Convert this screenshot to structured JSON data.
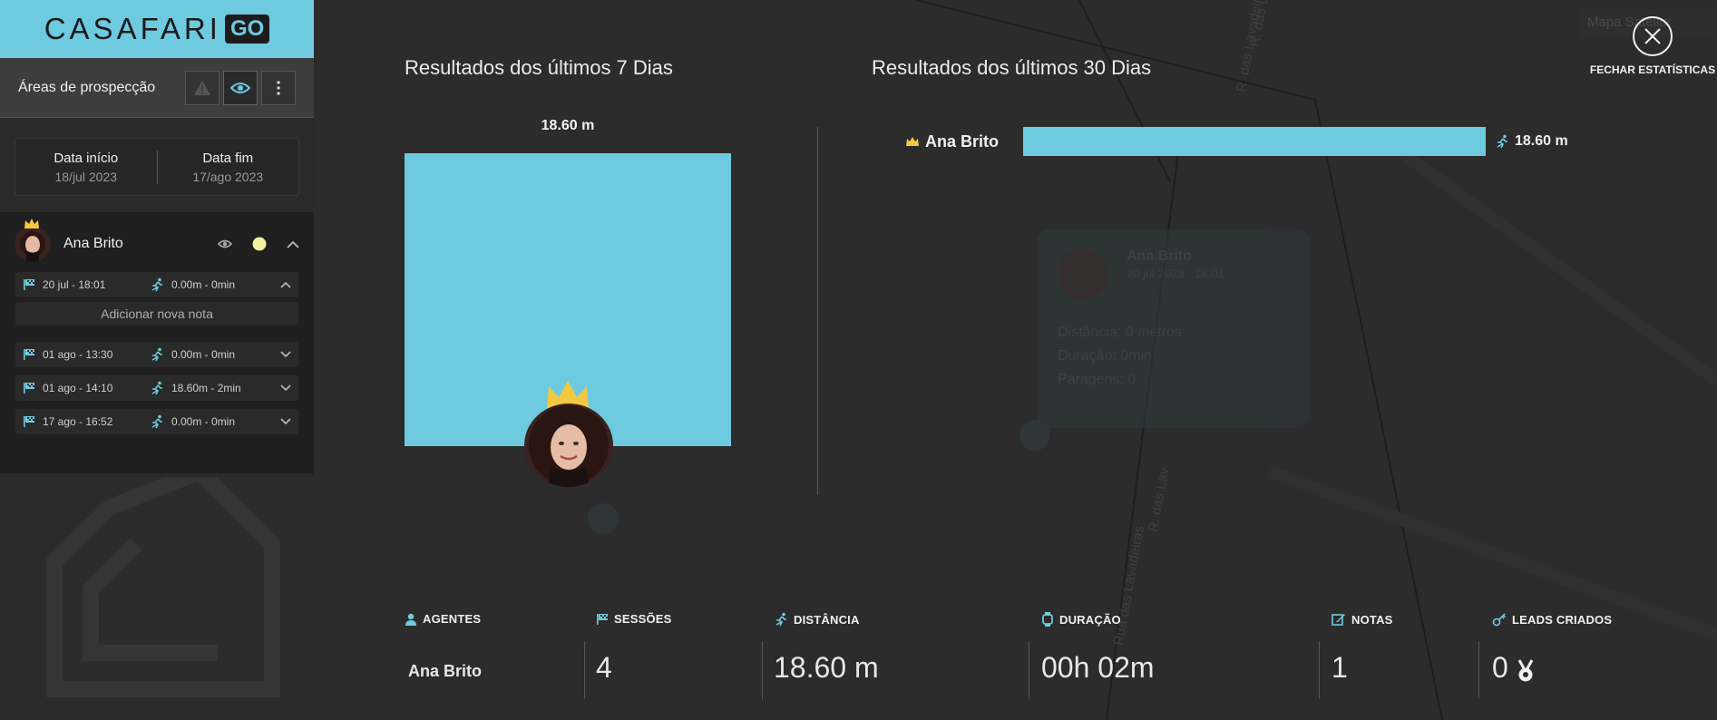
{
  "logo": {
    "text": "CASAFARI",
    "badge": "GO"
  },
  "sidebar": {
    "areas_title": "Áreas de prospecção",
    "date_start_label": "Data início",
    "date_start_value": "18/jul 2023",
    "date_end_label": "Data fim",
    "date_end_value": "17/ago 2023",
    "agent_name": "Ana Brito",
    "add_note_label": "Adicionar nova nota",
    "sessions": [
      {
        "date": "20 jul - 18:01",
        "distance": "0.00m - 0min",
        "expanded": true
      },
      {
        "date": "01 ago - 13:30",
        "distance": "0.00m - 0min",
        "expanded": false
      },
      {
        "date": "01 ago - 14:10",
        "distance": "18.60m - 2min",
        "expanded": false
      },
      {
        "date": "17 ago - 16:52",
        "distance": "0.00m - 0min",
        "expanded": false
      }
    ]
  },
  "stats": {
    "title_7_days": "Resultados dos últimos 7 Dias",
    "title_30_days": "Resultados dos últimos 30 Dias",
    "close_label": "FECHAR ESTATÍSTICAS",
    "map_button": "Mapa  Satélite"
  },
  "chart_data": [
    {
      "type": "bar",
      "categories": [
        "Ana Brito"
      ],
      "values": [
        18.6
      ],
      "title": "Resultados dos últimos 7 Dias",
      "data_labels": [
        "18.60 m"
      ]
    },
    {
      "type": "bar",
      "orientation": "horizontal",
      "categories": [
        "Ana Brito"
      ],
      "values": [
        18.6
      ],
      "title": "Resultados dos últimos 30 Dias",
      "data_labels": [
        "18.60 m"
      ]
    }
  ],
  "summary": {
    "agents_label": "AGENTES",
    "agents_value": "Ana Brito",
    "sessions_label": "SESSÕES",
    "sessions_value": "4",
    "distance_label": "DISTÂNCIA",
    "distance_value": "18.60 m",
    "duration_label": "DURAÇÃO",
    "duration_value": "00h 02m",
    "notes_label": "NOTAS",
    "notes_value": "1",
    "leads_label": "LEADS CRIADOS",
    "leads_value": "0"
  },
  "ghost_popup": {
    "name": "Ana Brito",
    "subtitle": "20 jul 2023 - 18:01",
    "distance": "Distância: 0 metros",
    "duration": "Duração: 0min",
    "stops": "Paragens: 0"
  },
  "map_labels": [
    "R. das Lavadeiras",
    "R. das Lavadeiras",
    "R. das Lav",
    "Rua das Lavadeiras"
  ],
  "colors": {
    "accent": "#6ecbdf",
    "crown": "#f5c842",
    "dot": "#f5f0a0"
  }
}
